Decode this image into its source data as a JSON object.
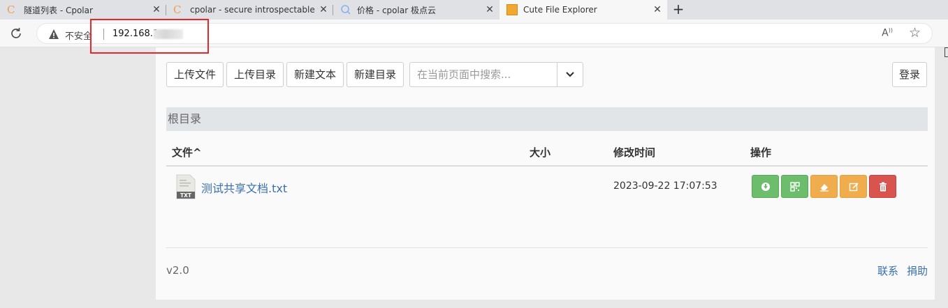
{
  "browser": {
    "tabs": [
      {
        "title": "隧道列表 - Cpolar",
        "favicon": "cpolar-c-icon"
      },
      {
        "title": "cpolar - secure introspectable tu",
        "favicon": "cpolar-c-icon"
      },
      {
        "title": "价格 - cpolar 极点云",
        "favicon": "search-icon"
      },
      {
        "title": "Cute File Explorer",
        "favicon": "cute-file-explorer-icon",
        "active": true
      }
    ],
    "new_tab": "+",
    "close_glyph": "✕",
    "address": {
      "security_label": "不安全",
      "url": "192.168.1"
    }
  },
  "toolbar": {
    "upload_file": "上传文件",
    "upload_dir": "上传目录",
    "new_text": "新建文本",
    "new_dir": "新建目录",
    "search_placeholder": "在当前页面中搜索...",
    "login": "登录"
  },
  "breadcrumb": "根目录",
  "table": {
    "headers": {
      "name": "文件^",
      "size": "大小",
      "modified": "修改时间",
      "actions": "操作"
    },
    "rows": [
      {
        "name": "测试共享文档.txt",
        "size": "",
        "modified": "2023-09-22 17:07:53",
        "icon_label": "TXT"
      }
    ]
  },
  "footer": {
    "version": "v2.0",
    "contact": "联系",
    "donate": "捐助"
  },
  "colors": {
    "green": "#6cbd6c",
    "orange": "#f0ad4e",
    "red": "#d9534f",
    "link": "#3a6fae",
    "highlight": "#e8262b"
  }
}
